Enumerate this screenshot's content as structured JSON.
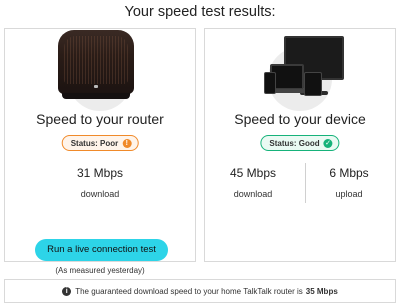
{
  "page": {
    "title": "Your speed test results:"
  },
  "router_card": {
    "heading": "Speed to your router",
    "status": {
      "label": "Status: Poor",
      "icon": "alert-icon",
      "color": "#f08a2a"
    },
    "download": {
      "value": "31 Mbps",
      "label": "download"
    },
    "cta": {
      "label": "Run a live connection test",
      "color": "#2dd4e8"
    },
    "note": "(As measured yesterday)"
  },
  "device_card": {
    "heading": "Speed to your device",
    "status": {
      "label": "Status: Good",
      "icon": "check-icon",
      "color": "#16b27a"
    },
    "download": {
      "value": "45 Mbps",
      "label": "download"
    },
    "upload": {
      "value": "6 Mbps",
      "label": "upload"
    }
  },
  "info_bar": {
    "icon": "info-icon",
    "text": "The guaranteed download speed to your home TalkTalk router is",
    "highlight": "35 Mbps"
  }
}
